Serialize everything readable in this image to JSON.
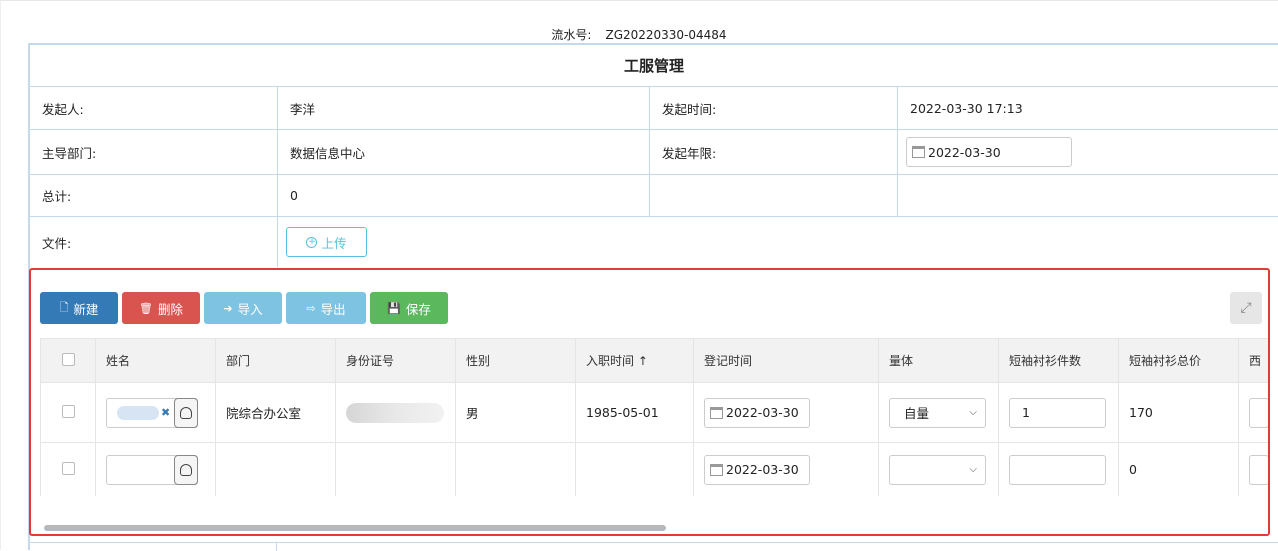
{
  "serial": {
    "label": "流水号:",
    "value": "ZG20220330-04484"
  },
  "form": {
    "title": "工服管理",
    "initiator_label": "发起人:",
    "initiator_value": "李洋",
    "time_label": "发起时间:",
    "time_value": "2022-03-30 17:13",
    "dept_label": "主导部门:",
    "dept_value": "数据信息中心",
    "deadline_label": "发起年限:",
    "deadline_value": "2022-03-30",
    "total_label": "总计:",
    "total_value": "0",
    "file_label": "文件:",
    "upload_label": "上传"
  },
  "toolbar": {
    "new_label": "新建",
    "delete_label": "删除",
    "import_label": "导入",
    "export_label": "导出",
    "save_label": "保存"
  },
  "table": {
    "headers": [
      "姓名",
      "部门",
      "身份证号",
      "性别",
      "入职时间 ↑",
      "登记时间",
      "量体",
      "短袖衬衫件数",
      "短袖衬衫总价",
      "西"
    ],
    "rows": [
      {
        "dept": "院综合办公室",
        "gender": "男",
        "hire_date": "1985-05-01",
        "reg_date": "2022-03-30",
        "measure": "自量",
        "shirt_count": "1",
        "shirt_total": "170"
      },
      {
        "dept": "",
        "gender": "",
        "hire_date": "",
        "reg_date": "2022-03-30",
        "measure": "",
        "shirt_count": "",
        "shirt_total": "0"
      }
    ]
  },
  "icons": {
    "new": "file-icon",
    "delete": "trash-icon",
    "import": "sign-in-icon",
    "export": "sign-out-icon",
    "save": "floppy-icon",
    "expand": "expand-icon",
    "calendar": "calendar-icon",
    "person": "user-icon"
  },
  "colors": {
    "primary": "#337ab7",
    "danger": "#d9534f",
    "info": "#7fc3e3",
    "success": "#5cb85c",
    "highlight_border": "#e53935",
    "form_border": "#c6d9ec"
  }
}
